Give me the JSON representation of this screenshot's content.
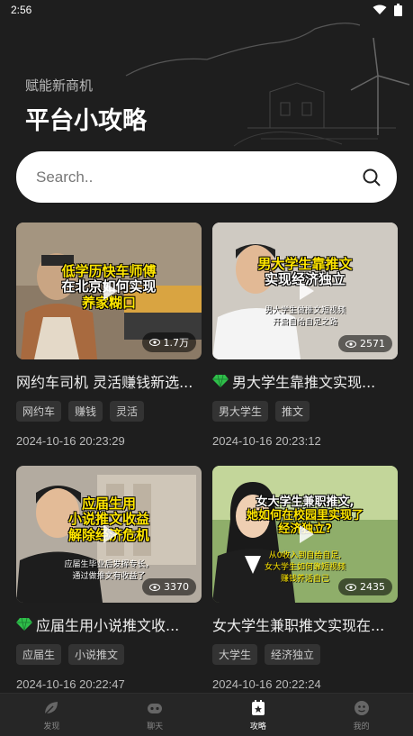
{
  "status": {
    "time": "2:56"
  },
  "header": {
    "subtitle": "赋能新商机",
    "title": "平台小攻略"
  },
  "search": {
    "placeholder": "Search.."
  },
  "cards": [
    {
      "overlay_lines": [
        "低学历快车师傅",
        "在北京如何实现",
        "养家糊口"
      ],
      "views": "1.7万",
      "title": "网约车司机 灵活赚钱新选...",
      "featured": false,
      "tags": [
        "网约车",
        "赚钱",
        "灵活"
      ],
      "date": "2024-10-16 20:23:29"
    },
    {
      "overlay_lines": [
        "男大学生靠推文",
        "实现经济独立"
      ],
      "overlay_small": [
        "男大学生做推文短视频",
        "开启自给自足之路"
      ],
      "views": "2571",
      "title": "男大学生靠推文实现...",
      "featured": true,
      "tags": [
        "男大学生",
        "推文"
      ],
      "date": "2024-10-16 20:23:12"
    },
    {
      "overlay_lines": [
        "应届生用",
        "小说推文收益",
        "解除经济危机"
      ],
      "overlay_small": [
        "应届生毕业后发挥专长，",
        "通过做推文有收益了"
      ],
      "views": "3370",
      "title": "应届生用小说推文收...",
      "featured": true,
      "tags": [
        "应届生",
        "小说推文"
      ],
      "date": "2024-10-16 20:22:47"
    },
    {
      "overlay_lines": [
        "女大学生兼职推文,",
        "她如何在校园里实现了",
        "经济独立?"
      ],
      "overlay_small": [
        "从0收入到自给自足,",
        "女大学生如何靠短视频",
        "赚钱养活自己"
      ],
      "views": "2435",
      "title": "女大学生兼职推文实现在...",
      "featured": false,
      "tags": [
        "大学生",
        "经济独立"
      ],
      "date": "2024-10-16 20:22:24"
    }
  ],
  "tabs": [
    {
      "label": "发现",
      "icon": "leaf-icon",
      "active": false
    },
    {
      "label": "聊天",
      "icon": "chat-icon",
      "active": false
    },
    {
      "label": "攻略",
      "icon": "star-note-icon",
      "active": true
    },
    {
      "label": "我的",
      "icon": "face-icon",
      "active": false
    }
  ],
  "colors": {
    "background": "#1e1e1e",
    "overlay_text": "#ffe600",
    "gem": "#2fbf4a"
  }
}
